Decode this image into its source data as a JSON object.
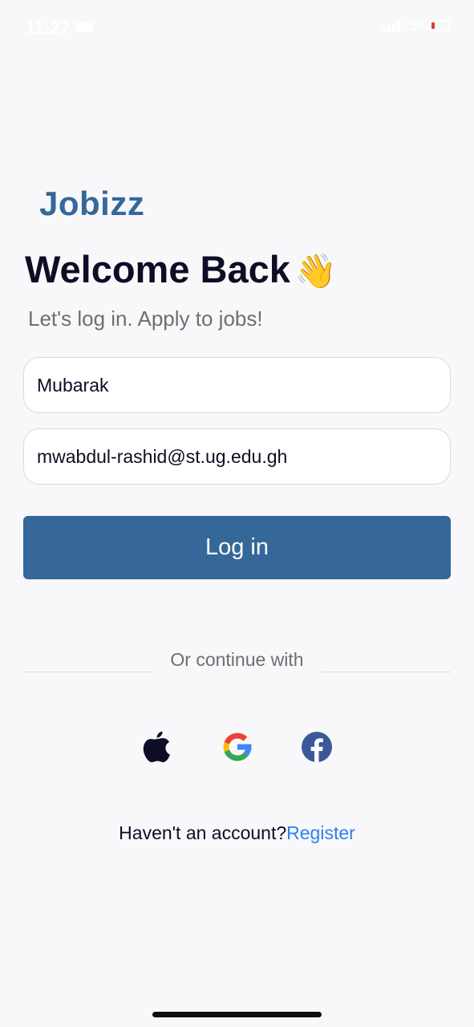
{
  "status_bar": {
    "time": "11:27",
    "battery_color": "#e53935"
  },
  "header": {
    "logo": "Jobizz",
    "title": "Welcome Back",
    "title_emoji": "👋",
    "subtitle": "Let's log in. Apply to jobs!"
  },
  "form": {
    "name_value": "Mubarak",
    "email_value": "mwabdul-rashid@st.ug.edu.gh",
    "login_label": "Log in"
  },
  "social": {
    "divider_text": "Or continue with",
    "providers": [
      "apple-icon",
      "google-icon",
      "facebook-icon"
    ]
  },
  "footer": {
    "prompt": "Haven't an account?",
    "register_label": "Register"
  },
  "colors": {
    "brand": "#356899",
    "link": "#2f80ed",
    "background": "#f8f8fa",
    "heading": "#0d0d26"
  }
}
